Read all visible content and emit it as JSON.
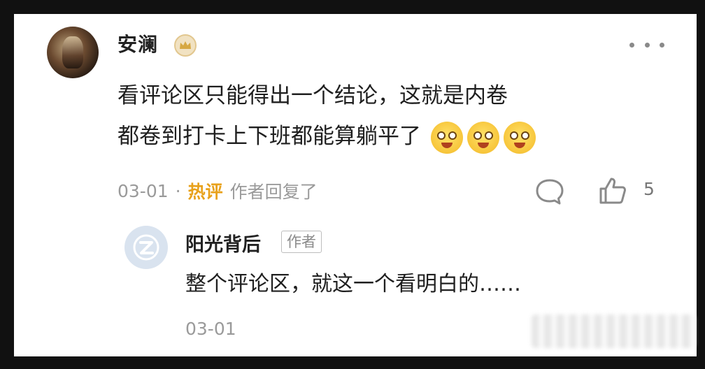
{
  "comment": {
    "author": "安澜",
    "text_line1": "看评论区只能得出一个结论，这就是内卷",
    "text_line2": "都卷到打卡上下班都能算躺平了",
    "emojis": [
      "drooling-face-icon",
      "drooling-face-icon",
      "drooling-face-icon"
    ],
    "date": "03-01",
    "separator": "·",
    "hot_label": "热评",
    "author_replied": "作者回复了",
    "like_count": "5"
  },
  "reply": {
    "author": "阳光背后",
    "tag": "作者",
    "text": "整个评论区，就这一个看明白的……",
    "date": "03-01"
  },
  "colors": {
    "hot": "#e8a11b",
    "meta": "#9a9a9a",
    "badge": "#e2c78f"
  }
}
